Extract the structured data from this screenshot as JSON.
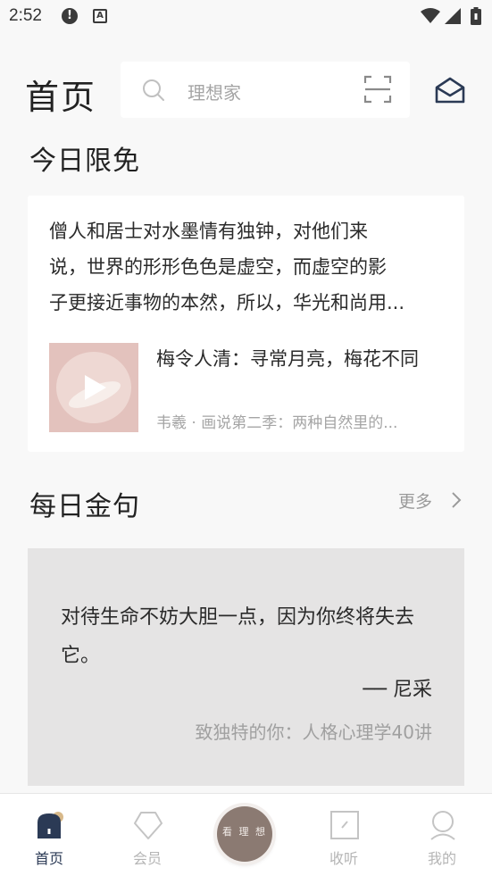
{
  "status_bar": {
    "time": "2:52",
    "icons": [
      "alert-icon",
      "a-icon",
      "wifi-icon",
      "signal-icon",
      "battery-icon"
    ],
    "a_glyph": "A"
  },
  "header": {
    "title": "首页",
    "search_placeholder": "理想家"
  },
  "free_section": {
    "title": "今日限免",
    "excerpt_lines": [
      "僧人和居士对水墨情有独钟，对他们来",
      "说，世界的形形色色是虚空，而虚空的影",
      "子更接近事物的本然，所以，华光和尚用..."
    ],
    "item": {
      "title": "梅令人清：寻常月亮，梅花不同",
      "subtitle": "韦羲 · 画说第二季：两种自然里的..."
    }
  },
  "quote_section": {
    "title": "每日金句",
    "more_label": "更多",
    "quote_text": "对待生命不妨大胆一点，因为你终将失去它。",
    "author": "── 尼采",
    "source": "致独特的你：人格心理学40讲"
  },
  "bottom_nav": {
    "items": [
      {
        "label": "首页",
        "icon": "home-icon",
        "active": true
      },
      {
        "label": "会员",
        "icon": "diamond-icon",
        "active": false
      },
      {
        "label": "看 理 想",
        "icon": "center-logo",
        "active": false
      },
      {
        "label": "收听",
        "icon": "listen-icon",
        "active": false
      },
      {
        "label": "我的",
        "icon": "profile-icon",
        "active": false
      }
    ]
  },
  "colors": {
    "accent": "#2b3a55",
    "inactive": "#b5b5b5",
    "quote_bg": "#e5e4e4",
    "center_button": "#8b7a72"
  }
}
